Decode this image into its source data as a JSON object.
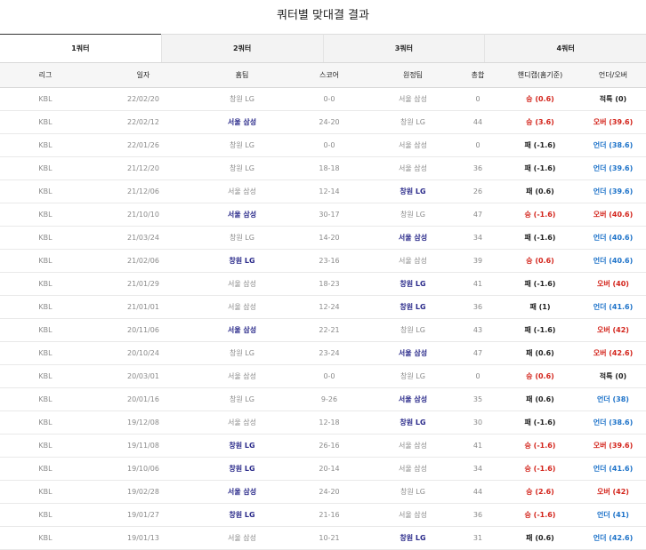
{
  "title": "쿼터별 맞대결 결과",
  "tabs": [
    "1쿼터",
    "2쿼터",
    "3쿼터",
    "4쿼터"
  ],
  "headers": [
    "리그",
    "일자",
    "홈팀",
    "스코어",
    "원정팀",
    "총합",
    "핸디캡(홈기준)",
    "언더/오버"
  ],
  "colors": {
    "win": "#d3241b",
    "over": "#d3241b",
    "under": "#1e73c9",
    "team": "#2a2a8a"
  },
  "rows": [
    {
      "league": "KBL",
      "date": "22/02/20",
      "home": "창원 LG",
      "score": "0-0",
      "away": "서울 삼성",
      "total": "0",
      "handicap": "승 (0.6)",
      "uo": "적특 (0)"
    },
    {
      "league": "KBL",
      "date": "22/02/12",
      "home": "서울 삼성",
      "score": "24-20",
      "away": "창원 LG",
      "total": "44",
      "handicap": "승 (3.6)",
      "uo": "오버 (39.6)"
    },
    {
      "league": "KBL",
      "date": "22/01/26",
      "home": "창원 LG",
      "score": "0-0",
      "away": "서울 삼성",
      "total": "0",
      "handicap": "패 (-1.6)",
      "uo": "언더 (38.6)"
    },
    {
      "league": "KBL",
      "date": "21/12/20",
      "home": "창원 LG",
      "score": "18-18",
      "away": "서울 삼성",
      "total": "36",
      "handicap": "패 (-1.6)",
      "uo": "언더 (39.6)"
    },
    {
      "league": "KBL",
      "date": "21/12/06",
      "home": "서울 삼성",
      "score": "12-14",
      "away": "창원 LG",
      "total": "26",
      "handicap": "패 (0.6)",
      "uo": "언더 (39.6)"
    },
    {
      "league": "KBL",
      "date": "21/10/10",
      "home": "서울 삼성",
      "score": "30-17",
      "away": "창원 LG",
      "total": "47",
      "handicap": "승 (-1.6)",
      "uo": "오버 (40.6)"
    },
    {
      "league": "KBL",
      "date": "21/03/24",
      "home": "창원 LG",
      "score": "14-20",
      "away": "서울 삼성",
      "total": "34",
      "handicap": "패 (-1.6)",
      "uo": "언더 (40.6)"
    },
    {
      "league": "KBL",
      "date": "21/02/06",
      "home": "창원 LG",
      "score": "23-16",
      "away": "서울 삼성",
      "total": "39",
      "handicap": "승 (0.6)",
      "uo": "언더 (40.6)"
    },
    {
      "league": "KBL",
      "date": "21/01/29",
      "home": "서울 삼성",
      "score": "18-23",
      "away": "창원 LG",
      "total": "41",
      "handicap": "패 (-1.6)",
      "uo": "오버 (40)"
    },
    {
      "league": "KBL",
      "date": "21/01/01",
      "home": "서울 삼성",
      "score": "12-24",
      "away": "창원 LG",
      "total": "36",
      "handicap": "패 (1)",
      "uo": "언더 (41.6)"
    },
    {
      "league": "KBL",
      "date": "20/11/06",
      "home": "서울 삼성",
      "score": "22-21",
      "away": "창원 LG",
      "total": "43",
      "handicap": "패 (-1.6)",
      "uo": "오버 (42)"
    },
    {
      "league": "KBL",
      "date": "20/10/24",
      "home": "창원 LG",
      "score": "23-24",
      "away": "서울 삼성",
      "total": "47",
      "handicap": "패 (0.6)",
      "uo": "오버 (42.6)"
    },
    {
      "league": "KBL",
      "date": "20/03/01",
      "home": "서울 삼성",
      "score": "0-0",
      "away": "창원 LG",
      "total": "0",
      "handicap": "승 (0.6)",
      "uo": "적특 (0)"
    },
    {
      "league": "KBL",
      "date": "20/01/16",
      "home": "창원 LG",
      "score": "9-26",
      "away": "서울 삼성",
      "total": "35",
      "handicap": "패 (0.6)",
      "uo": "언더 (38)"
    },
    {
      "league": "KBL",
      "date": "19/12/08",
      "home": "서울 삼성",
      "score": "12-18",
      "away": "창원 LG",
      "total": "30",
      "handicap": "패 (-1.6)",
      "uo": "언더 (38.6)"
    },
    {
      "league": "KBL",
      "date": "19/11/08",
      "home": "창원 LG",
      "score": "26-16",
      "away": "서울 삼성",
      "total": "41",
      "handicap": "승 (-1.6)",
      "uo": "오버 (39.6)"
    },
    {
      "league": "KBL",
      "date": "19/10/06",
      "home": "창원 LG",
      "score": "20-14",
      "away": "서울 삼성",
      "total": "34",
      "handicap": "승 (-1.6)",
      "uo": "언더 (41.6)"
    },
    {
      "league": "KBL",
      "date": "19/02/28",
      "home": "서울 삼성",
      "score": "24-20",
      "away": "창원 LG",
      "total": "44",
      "handicap": "승 (2.6)",
      "uo": "오버 (42)"
    },
    {
      "league": "KBL",
      "date": "19/01/27",
      "home": "창원 LG",
      "score": "21-16",
      "away": "서울 삼성",
      "total": "36",
      "handicap": "승 (-1.6)",
      "uo": "언더 (41)"
    },
    {
      "league": "KBL",
      "date": "19/01/13",
      "home": "서울 삼성",
      "score": "10-21",
      "away": "창원 LG",
      "total": "31",
      "handicap": "패 (0.6)",
      "uo": "언더 (42.6)"
    }
  ]
}
